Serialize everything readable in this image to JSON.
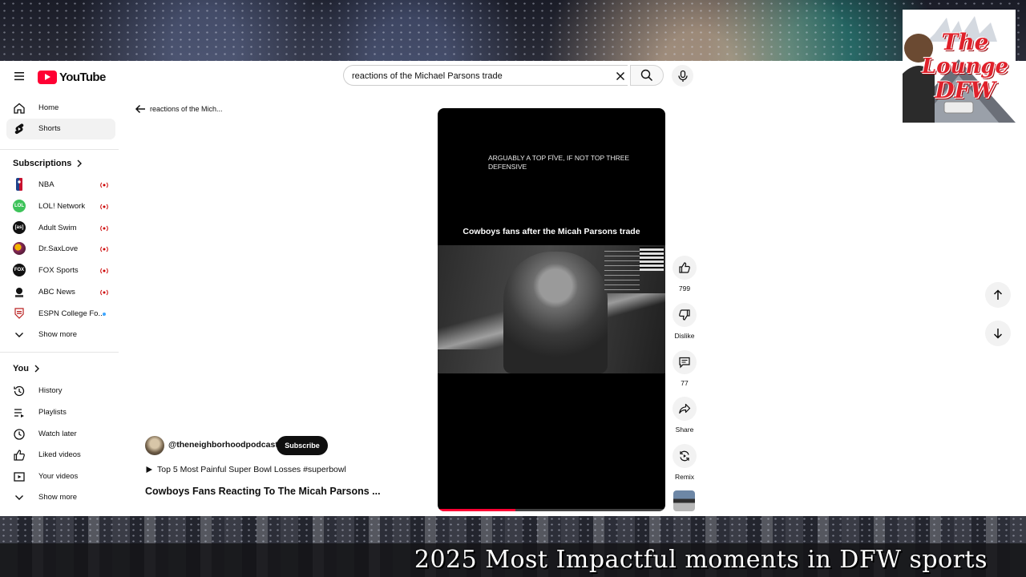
{
  "overlay": {
    "caption": "2025 Most Impactful moments in DFW sports",
    "logo_line1": "The",
    "logo_line2": "Lounge",
    "logo_line3": "DFW"
  },
  "masthead": {
    "logo_text": "YouTube",
    "search": {
      "value": "reactions of the Michael Parsons trade",
      "placeholder": "Search"
    }
  },
  "sidebar": {
    "main": [
      {
        "label": "Home",
        "icon": "home-icon"
      },
      {
        "label": "Shorts",
        "icon": "shorts-icon",
        "active": true
      }
    ],
    "subscriptions_heading": "Subscriptions",
    "subscriptions": [
      {
        "label": "NBA",
        "status": "live"
      },
      {
        "label": "LOL! Network",
        "status": "live"
      },
      {
        "label": "Adult Swim",
        "status": "live"
      },
      {
        "label": "Dr.SaxLove",
        "status": "live"
      },
      {
        "label": "FOX Sports",
        "status": "live"
      },
      {
        "label": "ABC News",
        "status": "live"
      },
      {
        "label": "ESPN College Fo...",
        "status": "new"
      }
    ],
    "show_more_1": "Show more",
    "you_heading": "You",
    "you": [
      {
        "label": "History",
        "icon": "history-icon"
      },
      {
        "label": "Playlists",
        "icon": "playlists-icon"
      },
      {
        "label": "Watch later",
        "icon": "watch-later-icon"
      },
      {
        "label": "Liked videos",
        "icon": "like-icon"
      },
      {
        "label": "Your videos",
        "icon": "your-videos-icon"
      }
    ],
    "show_more_2": "Show more"
  },
  "content": {
    "back_query": "reactions of the Mich...",
    "video": {
      "caption_top": "ARGUABLY A TOP FÏVE, IF NOT TOP THREE DEFENSIVE",
      "overlay_title": "Cowboys fans after the Micah Parsons trade",
      "progress": 0.34
    },
    "channel": {
      "handle": "@theneighborhoodpodcast",
      "subscribe_label": "Subscribe"
    },
    "linked_video": "Top 5 Most Painful Super Bowl Losses #superbowl",
    "title": "Cowboys Fans Reacting To The Micah Parsons ..."
  },
  "actions": {
    "like": "799",
    "dislike": "Dislike",
    "comments": "77",
    "share": "Share",
    "remix": "Remix"
  },
  "colors": {
    "brand_red": "#ff0033",
    "live_red": "#cc0000",
    "new_dot": "#3ea6ff"
  }
}
